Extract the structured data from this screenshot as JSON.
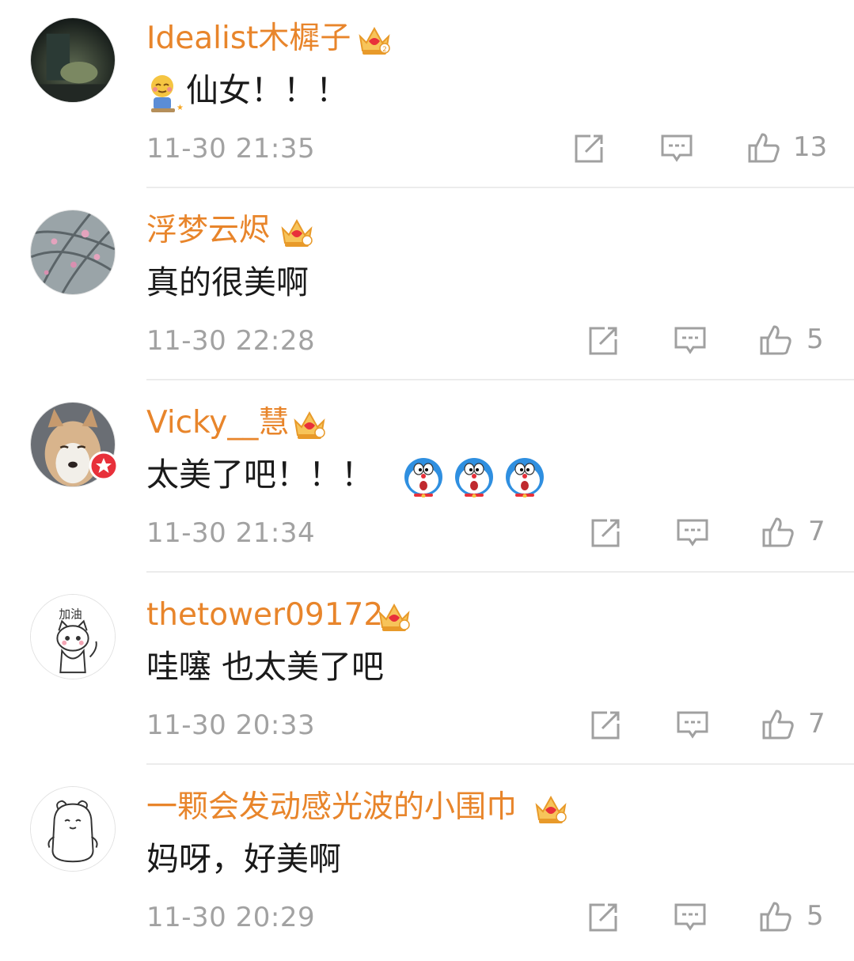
{
  "colors": {
    "username": "#e8852b",
    "text": "#1a1a1a",
    "meta": "#a2a2a2",
    "crown": "#f2a93b",
    "divider": "#ececec",
    "verified": "#e8303a"
  },
  "comments": [
    {
      "username": "Idealist木樨子",
      "text": "仙女！！！",
      "time": "11-30 21:35",
      "likes": "13",
      "avatar_icon": "avatar-photo-night",
      "crown_icon": "vip-crown-icon",
      "emoji": "blush-emoji"
    },
    {
      "username": "浮梦云烬",
      "text": "真的很美啊",
      "time": "11-30 22:28",
      "likes": "5",
      "avatar_icon": "avatar-photo-flowers",
      "crown_icon": "vip-crown-icon"
    },
    {
      "username": "Vicky__慧",
      "text": "太美了吧！！！",
      "time": "11-30 21:34",
      "likes": "7",
      "avatar_icon": "avatar-photo-dog",
      "crown_icon": "vip-crown-icon",
      "emoji": "doraemon-emoji",
      "verified": true
    },
    {
      "username": "thetower09172",
      "text": "哇噻 也太美了吧",
      "time": "11-30 20:33",
      "likes": "7",
      "avatar_icon": "avatar-drawing-cat",
      "avatar_text": "加油",
      "crown_icon": "vip-crown-icon"
    },
    {
      "username": "一颗会发动感光波的小围巾",
      "text": "妈呀，好美啊",
      "time": "11-30 20:29",
      "likes": "5",
      "avatar_icon": "avatar-drawing-bear",
      "crown_icon": "vip-crown-icon"
    }
  ]
}
